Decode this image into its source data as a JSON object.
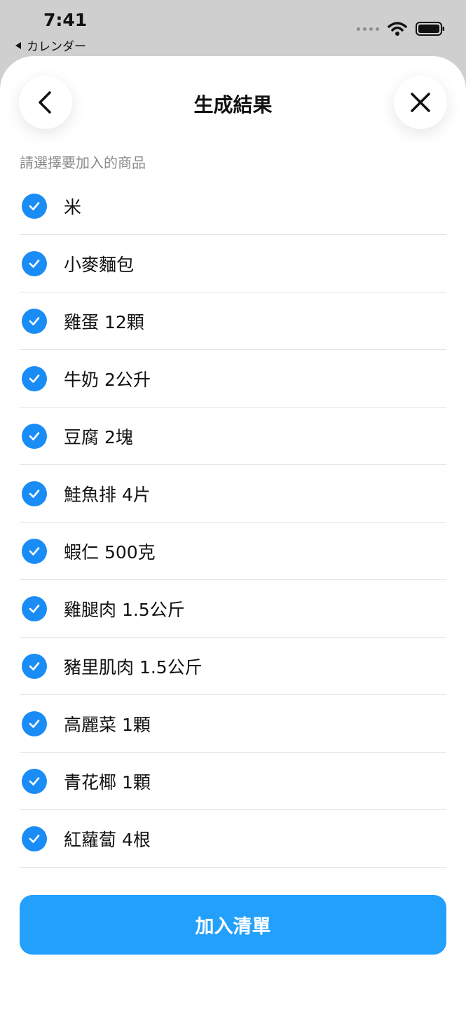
{
  "status_bar": {
    "time": "7:41",
    "back_label": "カレンダー"
  },
  "header": {
    "title": "生成結果"
  },
  "subtitle": "請選擇要加入的商品",
  "items": [
    {
      "label": "米",
      "checked": true
    },
    {
      "label": "小麥麵包",
      "checked": true
    },
    {
      "label": "雞蛋 12顆",
      "checked": true
    },
    {
      "label": "牛奶 2公升",
      "checked": true
    },
    {
      "label": "豆腐 2塊",
      "checked": true
    },
    {
      "label": "鮭魚排 4片",
      "checked": true
    },
    {
      "label": "蝦仁 500克",
      "checked": true
    },
    {
      "label": "雞腿肉 1.5公斤",
      "checked": true
    },
    {
      "label": "豬里肌肉 1.5公斤",
      "checked": true
    },
    {
      "label": "高麗菜 1顆",
      "checked": true
    },
    {
      "label": "青花椰 1顆",
      "checked": true
    },
    {
      "label": "紅蘿蔔 4根",
      "checked": true
    }
  ],
  "primary_button": {
    "label": "加入清單"
  },
  "colors": {
    "accent": "#1a8cf5",
    "button": "#23a0fb"
  },
  "icons": {
    "back": "chevron-left-icon",
    "close": "close-icon",
    "check": "checkmark-icon",
    "wifi": "wifi-icon",
    "battery": "battery-icon"
  }
}
